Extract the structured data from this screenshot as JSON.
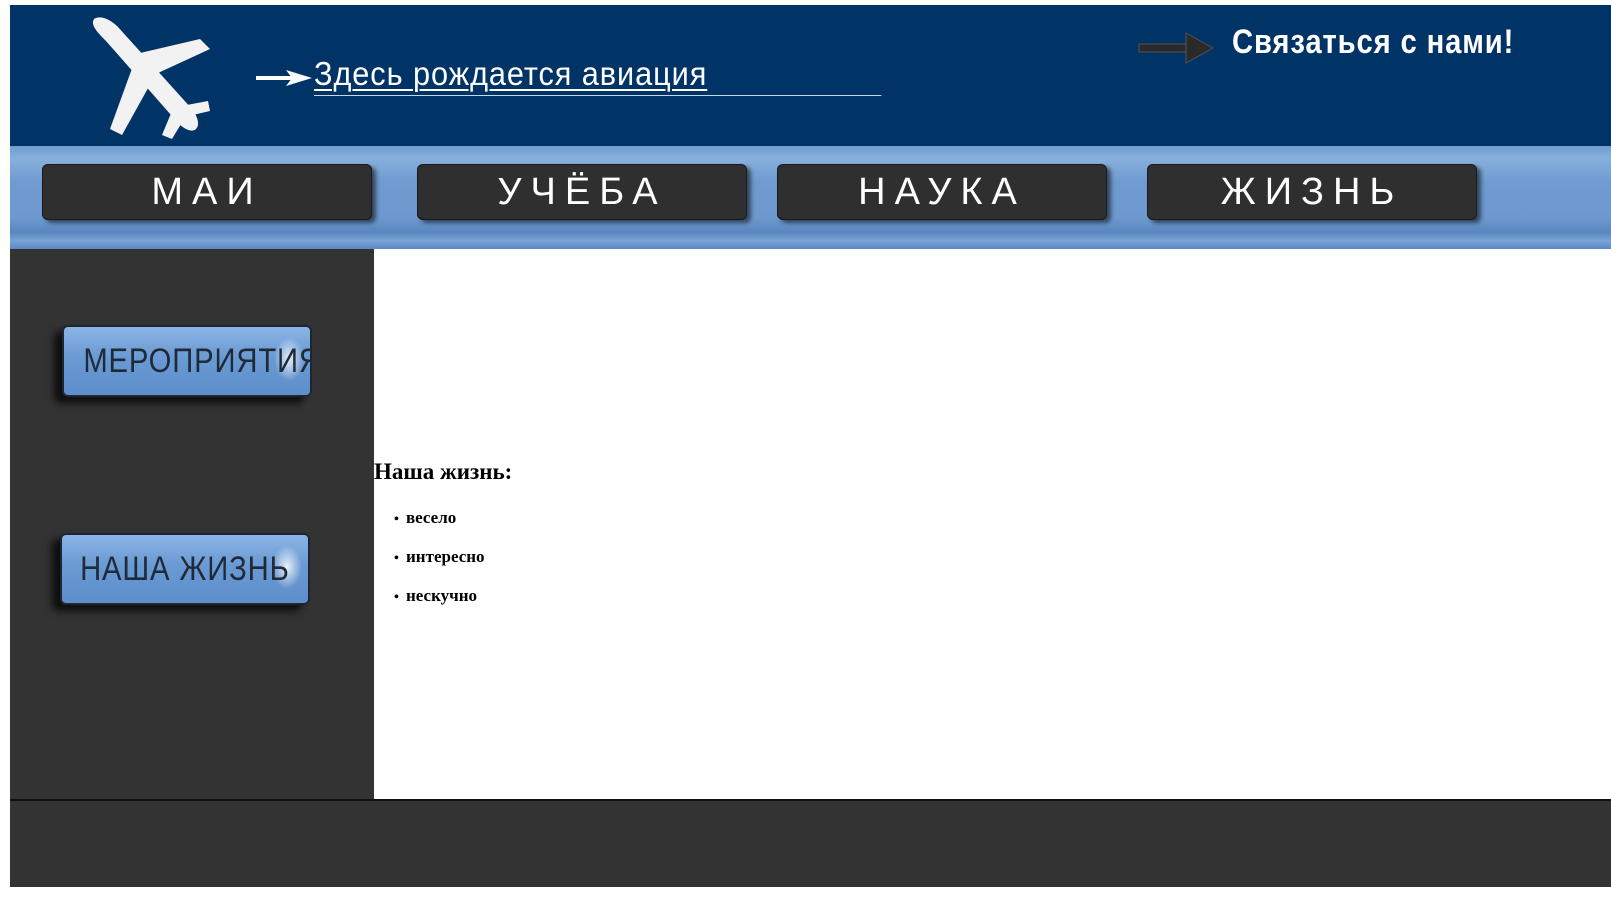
{
  "header": {
    "tagline": "Здесь рождается авиация",
    "contact_label": "Связаться с нами!",
    "logo_icon": "airplane-icon",
    "tagline_arrow_icon": "arrow-right-icon",
    "contact_arrow_icon": "arrow-right-icon"
  },
  "nav": {
    "items": [
      {
        "label": "МАИ"
      },
      {
        "label": "УЧЁБА"
      },
      {
        "label": "НАУКА"
      },
      {
        "label": "ЖИЗНЬ"
      }
    ]
  },
  "sidebar": {
    "items": [
      {
        "label": "МЕРОПРИЯТИЯ"
      },
      {
        "label": "НАША ЖИЗНЬ"
      }
    ]
  },
  "content": {
    "heading": "Наша жизнь:",
    "list": [
      "весело",
      "интересно",
      "нескучно"
    ]
  },
  "colors": {
    "header_bg": "#003366",
    "nav_bg": "#6f9bd0",
    "nav_button_bg": "#2f2f2f",
    "sidebar_bg": "#333333",
    "side_button_bg": "#6a9ad3",
    "footer_bg": "#333333"
  }
}
